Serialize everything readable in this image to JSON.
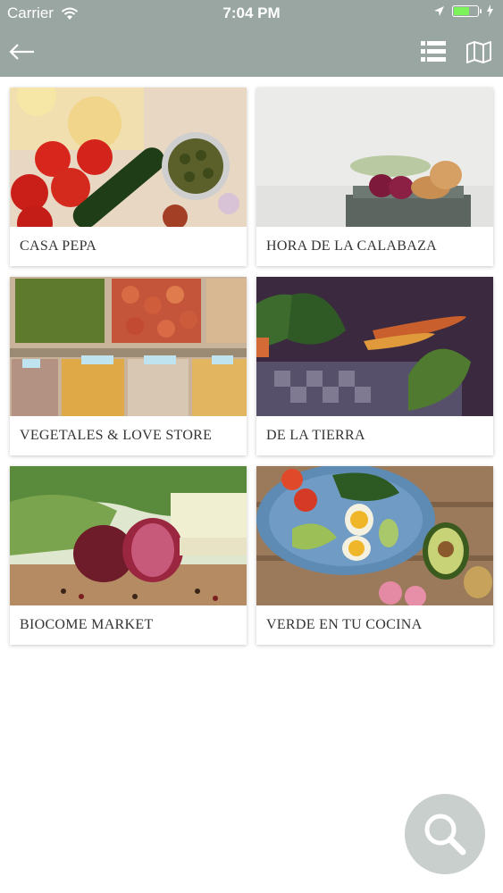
{
  "status": {
    "carrier": "Carrier",
    "time": "7:04 PM"
  },
  "navbar": {
    "back_icon": "arrow-left-icon",
    "list_icon": "list-view-icon",
    "map_icon": "map-icon",
    "bar_color": "#9aa6a1"
  },
  "stores": [
    {
      "name": "CASA PEPA"
    },
    {
      "name": "HORA DE LA CALABAZA"
    },
    {
      "name": "VEGETALES & LOVE STORE"
    },
    {
      "name": "DE LA TIERRA"
    },
    {
      "name": "BIOCOME MARKET"
    },
    {
      "name": "VERDE EN TU COCINA"
    }
  ],
  "fab": {
    "icon": "search-icon",
    "color": "#c9cfcd"
  }
}
